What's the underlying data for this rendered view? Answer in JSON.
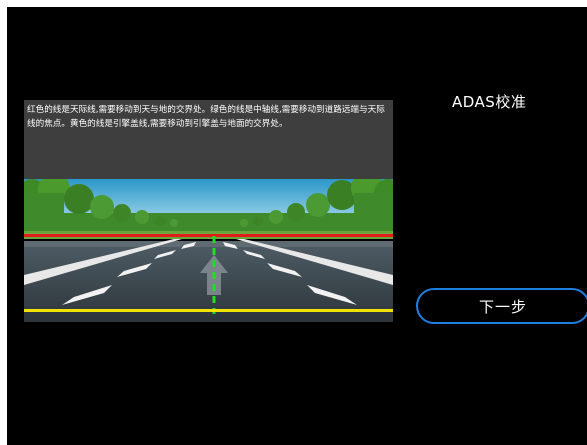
{
  "screen": {
    "title": "ADAS校准",
    "instructions": "红色的线是天际线,需要移动到天与地的交界处。绿色的线是中轴线,需要移动到道路远端与天际线的焦点。黄色的线是引擎盖线,需要移动到引擎盖与地面的交界处。",
    "next_button_label": "下一步"
  },
  "guide_lines": {
    "horizon": {
      "name": "红色的线",
      "color": "#e21b1b"
    },
    "center_axis": {
      "name": "绿色的线",
      "color": "#1ee01e"
    },
    "hood": {
      "name": "黄色的线",
      "color": "#f2e200"
    }
  },
  "colors": {
    "background": "#000000",
    "button_border": "#1f7fe0",
    "text": "#ffffff",
    "instruction_panel": "#3e3e3e"
  }
}
